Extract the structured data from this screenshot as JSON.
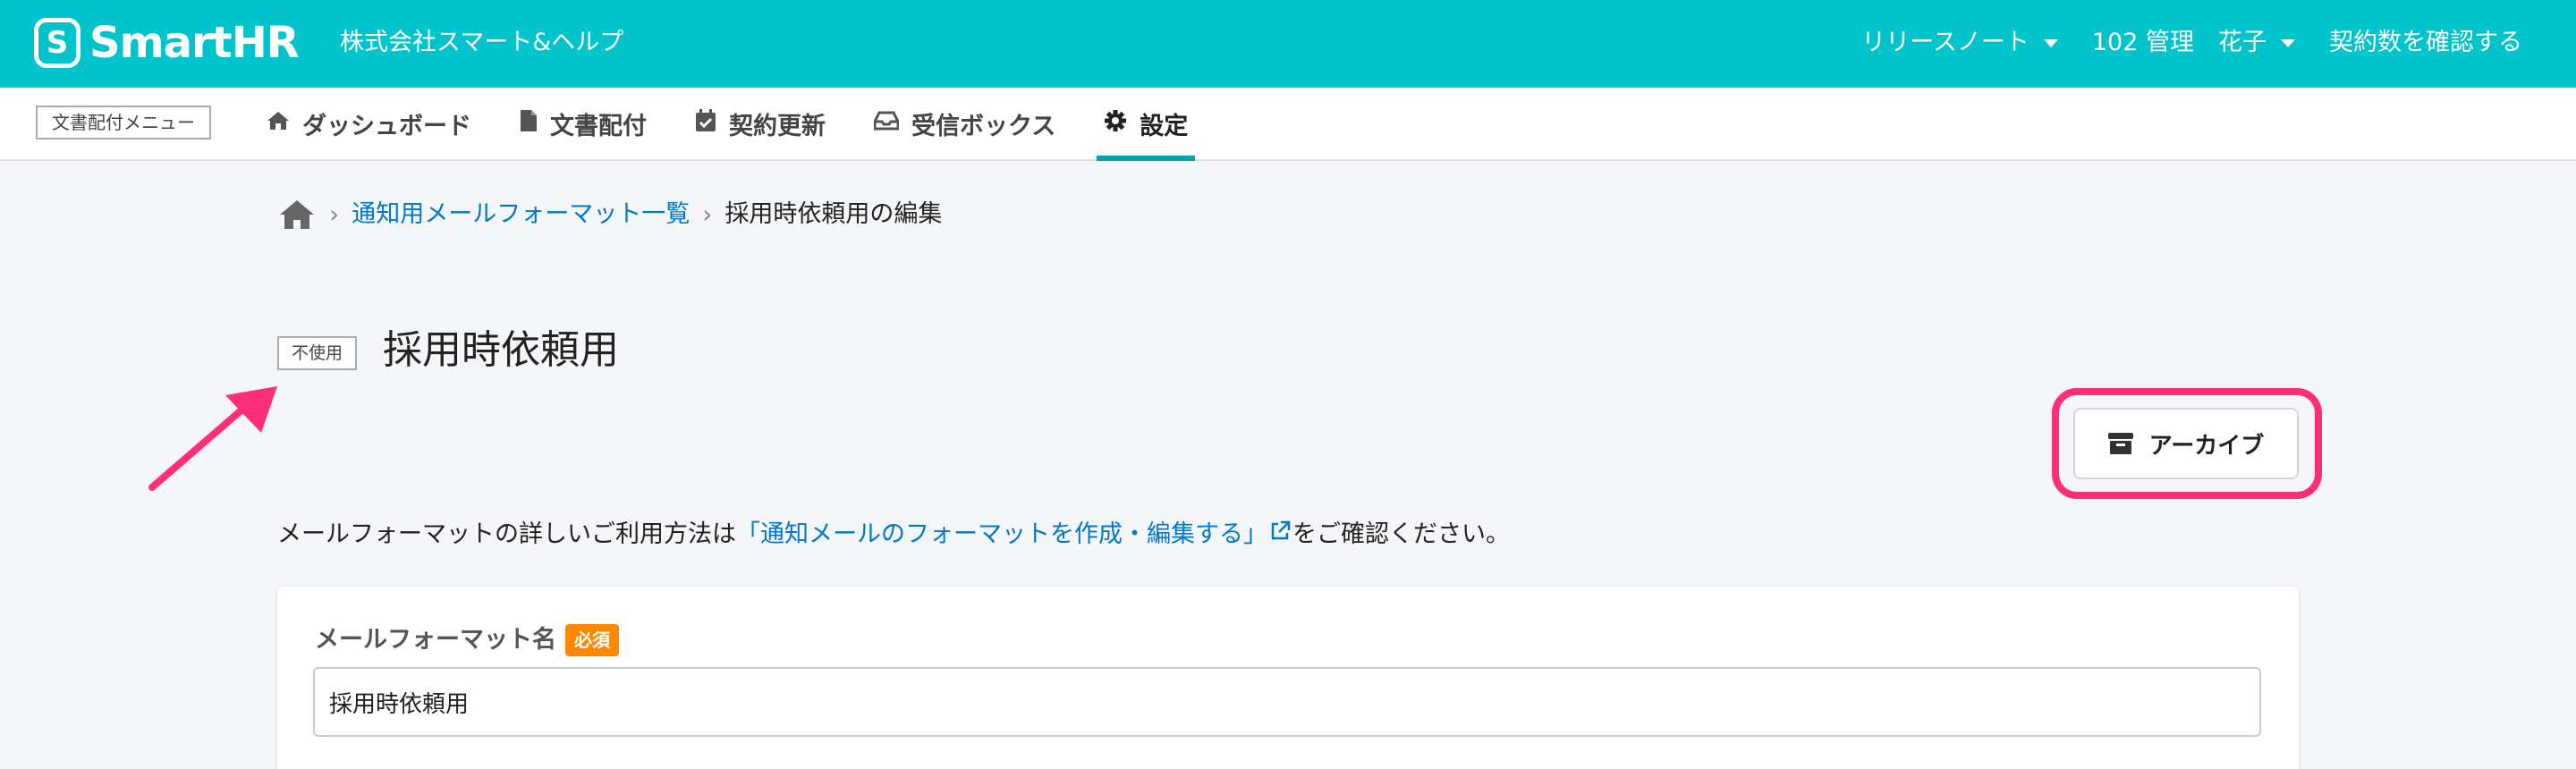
{
  "header": {
    "logo_text": "SmartHR",
    "logo_mark": "S",
    "tenant": "株式会社スマート&ヘルプ",
    "release_notes": "リリースノート",
    "user": "102 管理　花子",
    "contract": "契約数を確認する"
  },
  "nav": {
    "menu_label": "文書配付メニュー",
    "tabs": [
      {
        "label": "ダッシュボード",
        "icon": "home-icon"
      },
      {
        "label": "文書配付",
        "icon": "file-icon"
      },
      {
        "label": "契約更新",
        "icon": "calendar-check-icon"
      },
      {
        "label": "受信ボックス",
        "icon": "inbox-icon"
      },
      {
        "label": "設定",
        "icon": "gear-icon",
        "active": true
      }
    ]
  },
  "breadcrumb": {
    "link": "通知用メールフォーマット一覧",
    "current": "採用時依頼用の編集"
  },
  "page": {
    "status_tag": "不使用",
    "title": "採用時依頼用",
    "archive_button": "アーカイブ",
    "info_before": "メールフォーマットの詳しいご利用方法は",
    "info_link": "「通知メールのフォーマットを作成・編集する」",
    "info_after": "をご確認ください。"
  },
  "form": {
    "name_label": "メールフォーマット名",
    "required_badge": "必須",
    "name_value": "採用時依頼用"
  },
  "colors": {
    "brand": "#00c4cc",
    "link": "#0077c7",
    "highlight": "#ff2e7a",
    "required": "#ff8800"
  }
}
